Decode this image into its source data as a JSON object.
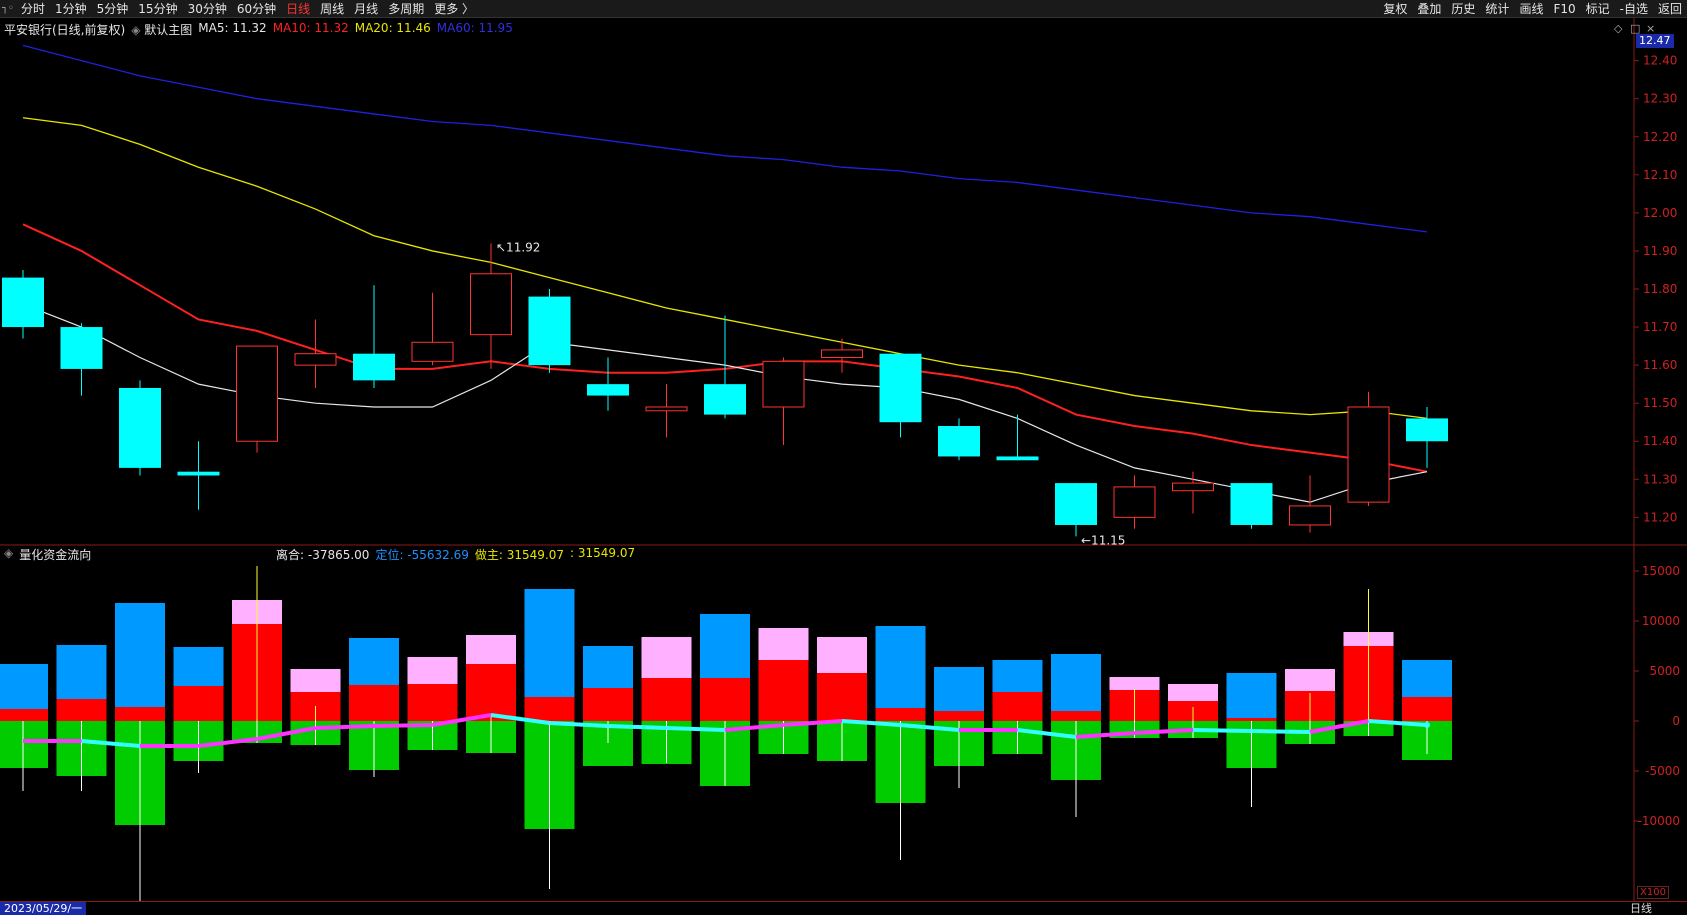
{
  "toolbar": {
    "left_icon": "┐◦",
    "tabs": [
      {
        "label": "分时",
        "active": false
      },
      {
        "label": "1分钟",
        "active": false
      },
      {
        "label": "5分钟",
        "active": false
      },
      {
        "label": "15分钟",
        "active": false
      },
      {
        "label": "30分钟",
        "active": false
      },
      {
        "label": "60分钟",
        "active": false
      },
      {
        "label": "日线",
        "active": true
      },
      {
        "label": "周线",
        "active": false
      },
      {
        "label": "月线",
        "active": false
      },
      {
        "label": "多周期",
        "active": false
      },
      {
        "label": "更多 〉",
        "active": false
      }
    ],
    "right_tabs": [
      "复权",
      "叠加",
      "历史",
      "统计",
      "画线",
      "F10",
      "标记",
      "-自选",
      "返回"
    ]
  },
  "main_legend": {
    "title": "平安银行(日线,前复权)",
    "template": "默认主图",
    "ma5": "MA5: 11.32",
    "ma10": "MA10: 11.32",
    "ma20": "MA20: 11.46",
    "ma60": "MA60: 11.95"
  },
  "sub_legend": {
    "title": "量化资金流向",
    "v1": "离合: -37865.00",
    "v2_label": "定位: ",
    "v2": "-55632.69",
    "v3_label": "做主: ",
    "v3": "31549.07",
    "v4": ": 31549.07"
  },
  "current_price_badge": "12.47",
  "bottom": {
    "date": "2023/05/29/一",
    "period": "日线",
    "scale": "X100"
  },
  "window_controls": [
    "◇",
    "□",
    "×"
  ],
  "colors": {
    "up": "#ff3333",
    "down": "#00ffff",
    "ma5": "#e6e6e6",
    "ma10": "#ff2020",
    "ma20": "#e6e600",
    "ma60": "#2020e0",
    "axis": "#8b1a1a",
    "tick_text": "#cc2222",
    "flow_big_buy": "#ff0000",
    "flow_super_buy": "#ffb0ff",
    "flow_sell_blue": "#0099ff",
    "flow_green": "#00cc00"
  },
  "chart_data": {
    "type": "candlestick",
    "y_axis_main": {
      "ticks": [
        12.4,
        12.3,
        12.2,
        12.1,
        12.0,
        11.9,
        11.8,
        11.7,
        11.6,
        11.5,
        11.4,
        11.3,
        11.2
      ],
      "range": [
        11.13,
        12.47
      ]
    },
    "y_axis_sub": {
      "ticks": [
        15000,
        10000,
        5000,
        0,
        -5000,
        -10000
      ],
      "range": [
        -18000,
        17500
      ]
    },
    "annotations": [
      {
        "label": "11.92",
        "index": 8,
        "price": 11.92
      },
      {
        "label": "11.15",
        "index": 18,
        "price": 11.15
      }
    ],
    "candles": [
      {
        "o": 11.83,
        "h": 11.85,
        "l": 11.67,
        "c": 11.7
      },
      {
        "o": 11.7,
        "h": 11.71,
        "l": 11.52,
        "c": 11.59
      },
      {
        "o": 11.54,
        "h": 11.56,
        "l": 11.31,
        "c": 11.33
      },
      {
        "o": 11.32,
        "h": 11.4,
        "l": 11.22,
        "c": 11.31
      },
      {
        "o": 11.4,
        "h": 11.65,
        "l": 11.37,
        "c": 11.65
      },
      {
        "o": 11.6,
        "h": 11.72,
        "l": 11.54,
        "c": 11.63
      },
      {
        "o": 11.63,
        "h": 11.81,
        "l": 11.54,
        "c": 11.56
      },
      {
        "o": 11.61,
        "h": 11.79,
        "l": 11.6,
        "c": 11.66
      },
      {
        "o": 11.68,
        "h": 11.92,
        "l": 11.59,
        "c": 11.84
      },
      {
        "o": 11.78,
        "h": 11.8,
        "l": 11.58,
        "c": 11.6
      },
      {
        "o": 11.55,
        "h": 11.62,
        "l": 11.48,
        "c": 11.52
      },
      {
        "o": 11.48,
        "h": 11.55,
        "l": 11.41,
        "c": 11.49
      },
      {
        "o": 11.55,
        "h": 11.73,
        "l": 11.46,
        "c": 11.47
      },
      {
        "o": 11.49,
        "h": 11.62,
        "l": 11.39,
        "c": 11.61
      },
      {
        "o": 11.62,
        "h": 11.67,
        "l": 11.58,
        "c": 11.64
      },
      {
        "o": 11.63,
        "h": 11.63,
        "l": 11.41,
        "c": 11.45
      },
      {
        "o": 11.44,
        "h": 11.46,
        "l": 11.35,
        "c": 11.36
      },
      {
        "o": 11.36,
        "h": 11.47,
        "l": 11.35,
        "c": 11.35
      },
      {
        "o": 11.29,
        "h": 11.29,
        "l": 11.15,
        "c": 11.18
      },
      {
        "o": 11.2,
        "h": 11.31,
        "l": 11.17,
        "c": 11.28
      },
      {
        "o": 11.27,
        "h": 11.32,
        "l": 11.21,
        "c": 11.29
      },
      {
        "o": 11.29,
        "h": 11.29,
        "l": 11.17,
        "c": 11.18
      },
      {
        "o": 11.18,
        "h": 11.31,
        "l": 11.16,
        "c": 11.23
      },
      {
        "o": 11.24,
        "h": 11.53,
        "l": 11.23,
        "c": 11.49
      },
      {
        "o": 11.46,
        "h": 11.49,
        "l": 11.33,
        "c": 11.4
      }
    ],
    "ma5": [
      11.76,
      11.7,
      11.62,
      11.55,
      11.52,
      11.5,
      11.49,
      11.49,
      11.56,
      11.66,
      11.64,
      11.62,
      11.6,
      11.57,
      11.55,
      11.54,
      11.51,
      11.46,
      11.39,
      11.33,
      11.3,
      11.27,
      11.24,
      11.29,
      11.32
    ],
    "ma10": [
      11.97,
      11.9,
      11.81,
      11.72,
      11.69,
      11.64,
      11.59,
      11.59,
      11.61,
      11.59,
      11.58,
      11.58,
      11.59,
      11.61,
      11.61,
      11.59,
      11.57,
      11.54,
      11.47,
      11.44,
      11.42,
      11.39,
      11.37,
      11.35,
      11.32
    ],
    "ma20": [
      12.25,
      12.23,
      12.18,
      12.12,
      12.07,
      12.01,
      11.94,
      11.9,
      11.87,
      11.83,
      11.79,
      11.75,
      11.72,
      11.69,
      11.66,
      11.63,
      11.6,
      11.58,
      11.55,
      11.52,
      11.5,
      11.48,
      11.47,
      11.48,
      11.46
    ],
    "ma60": [
      12.44,
      12.4,
      12.36,
      12.33,
      12.3,
      12.28,
      12.26,
      12.24,
      12.23,
      12.21,
      12.19,
      12.17,
      12.15,
      12.14,
      12.12,
      12.11,
      12.09,
      12.08,
      12.06,
      12.04,
      12.02,
      12.0,
      11.99,
      11.97,
      11.95
    ],
    "flow": [
      {
        "blue": 5700,
        "red": 1200,
        "pink": 0,
        "green": -4700
      },
      {
        "blue": 7600,
        "red": 2200,
        "pink": 0,
        "green": -5500
      },
      {
        "blue": 11800,
        "red": 1400,
        "pink": 0,
        "green": -10400
      },
      {
        "blue": 7400,
        "red": 3500,
        "pink": 0,
        "green": -4000
      },
      {
        "blue": 0,
        "red": 9700,
        "pink": 2400,
        "green": -2200
      },
      {
        "blue": 0,
        "red": 2900,
        "pink": 2300,
        "green": -2400
      },
      {
        "blue": 8300,
        "red": 3600,
        "pink": 0,
        "green": -4900
      },
      {
        "blue": 0,
        "red": 3700,
        "pink": 2700,
        "green": -2900
      },
      {
        "blue": 0,
        "red": 5700,
        "pink": 2900,
        "green": -3200
      },
      {
        "blue": 13200,
        "red": 2400,
        "pink": 0,
        "green": -10800
      },
      {
        "blue": 7500,
        "red": 3300,
        "pink": 0,
        "green": -4500
      },
      {
        "blue": 0,
        "red": 4300,
        "pink": 4100,
        "green": -4300
      },
      {
        "blue": 10700,
        "red": 4300,
        "pink": 0,
        "green": -6500
      },
      {
        "blue": 0,
        "red": 6100,
        "pink": 3200,
        "green": -3300
      },
      {
        "blue": 0,
        "red": 4800,
        "pink": 3600,
        "green": -4000
      },
      {
        "blue": 9500,
        "red": 1300,
        "pink": 0,
        "green": -8200
      },
      {
        "blue": 5400,
        "red": 1000,
        "pink": 0,
        "green": -4500
      },
      {
        "blue": 6100,
        "red": 2900,
        "pink": 0,
        "green": -3300
      },
      {
        "blue": 6700,
        "red": 1000,
        "pink": 0,
        "green": -5900
      },
      {
        "blue": 0,
        "red": 3100,
        "pink": 1300,
        "green": -1700
      },
      {
        "blue": 0,
        "red": 2000,
        "pink": 1700,
        "green": -1700
      },
      {
        "blue": 4800,
        "red": 300,
        "pink": 0,
        "green": -4700
      },
      {
        "blue": 0,
        "red": 3000,
        "pink": 2200,
        "green": -2300
      },
      {
        "blue": 0,
        "red": 7500,
        "pink": 1400,
        "green": -1500
      },
      {
        "blue": 6100,
        "red": 2400,
        "pink": 0,
        "green": -3900
      }
    ],
    "flow_wick_high": [
      0,
      0,
      0,
      0,
      15500,
      1500,
      0,
      0,
      700,
      0,
      0,
      0,
      0,
      0,
      0,
      0,
      0,
      0,
      0,
      3200,
      1400,
      0,
      2800,
      13200,
      0
    ],
    "flow_wick_low": [
      -7000,
      -7000,
      -18000,
      -5200,
      -2200,
      -2400,
      -5600,
      -2900,
      -3200,
      -16800,
      -2200,
      -4200,
      -6500,
      -3300,
      -4000,
      -13900,
      -6700,
      -3300,
      -9600,
      -1700,
      -1700,
      -8600,
      -2300,
      -1500,
      -3300
    ],
    "flow_line": [
      -2000,
      -2000,
      -2500,
      -2500,
      -1800,
      -700,
      -500,
      -400,
      600,
      -200,
      -500,
      -700,
      -900,
      -400,
      0,
      -400,
      -900,
      -900,
      -1600,
      -1200,
      -900,
      -1000,
      -1100,
      0,
      -400
    ]
  }
}
